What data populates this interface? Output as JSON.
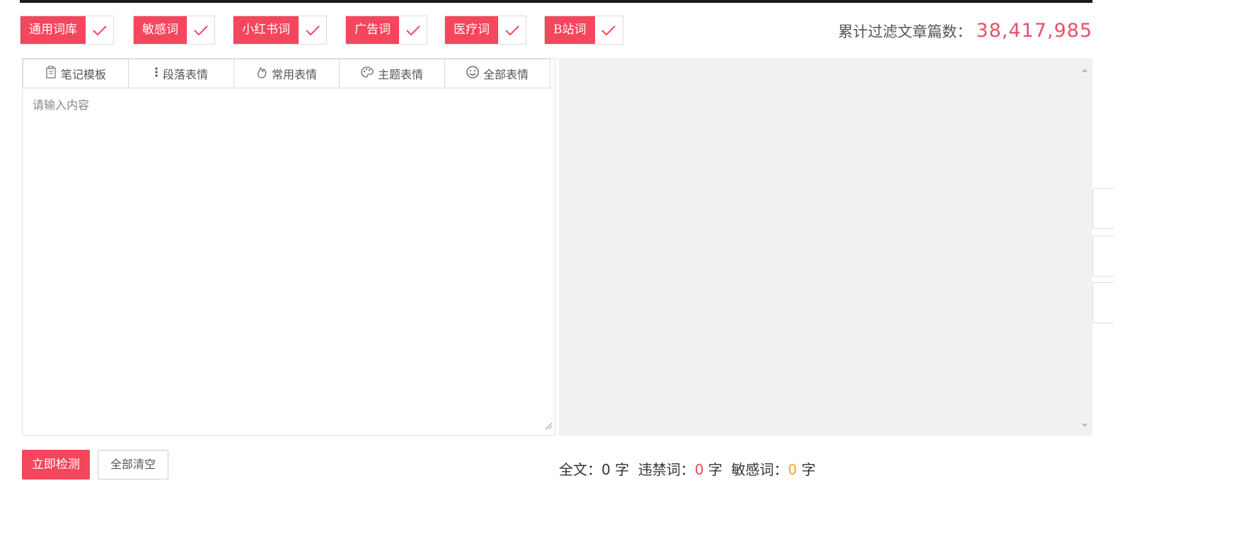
{
  "filters": [
    {
      "label": "通用词库",
      "checked": true
    },
    {
      "label": "敏感词",
      "checked": true
    },
    {
      "label": "小红书词",
      "checked": true
    },
    {
      "label": "广告词",
      "checked": true
    },
    {
      "label": "医疗词",
      "checked": true
    },
    {
      "label": "B站词",
      "checked": true
    }
  ],
  "counter": {
    "label": "累计过滤文章篇数：",
    "value": "38,417,985"
  },
  "toolbar": {
    "note_template": "笔记模板",
    "paragraph_emoji": "段落表情",
    "common_emoji": "常用表情",
    "theme_emoji": "主题表情",
    "all_emoji": "全部表情"
  },
  "editor": {
    "placeholder": "请输入内容"
  },
  "actions": {
    "check": "立即检测",
    "clear": "全部清空"
  },
  "stats": {
    "fulltext_label": "全文：",
    "fulltext_count": "0",
    "banned_label": "违禁词：",
    "banned_count": "0",
    "sensitive_label": "敏感词：",
    "sensitive_count": "0",
    "unit": "字"
  },
  "colors": {
    "accent": "#f4465c",
    "warn": "#f6a623",
    "counter": "#e5526b"
  }
}
